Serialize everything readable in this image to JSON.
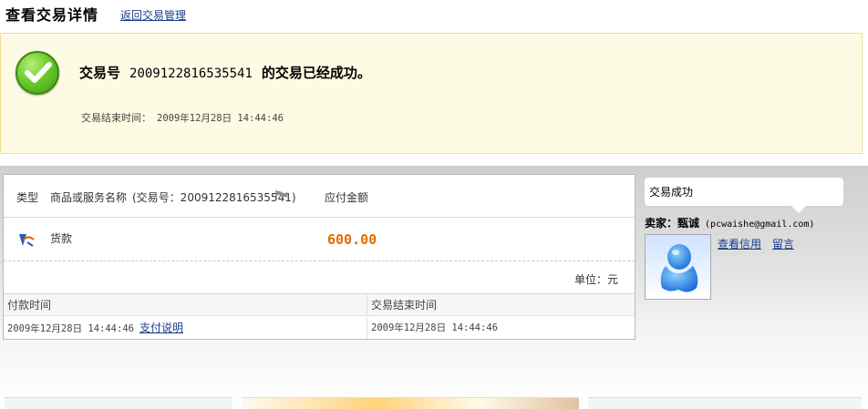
{
  "header": {
    "title": "查看交易详情",
    "back_link": "返回交易管理"
  },
  "success": {
    "prefix": "交易号",
    "trade_no": "2009122816535541",
    "suffix": "的交易已经成功。",
    "end_time_label": "交易结束时间：",
    "end_time_value": "2009年12月28日 14:44:46"
  },
  "order": {
    "col_type": "类型",
    "col_name": "商品或服务名称",
    "col_trade_no": "(交易号：2009122816535541)",
    "col_amount": "应付金额",
    "item_name": "货款",
    "item_amount": "600.00",
    "unit": "单位：元",
    "pay_time_header": "付款时间",
    "end_time_header": "交易结束时间",
    "pay_time_value": "2009年12月28日 14:44:46",
    "pay_note_link": "支付说明",
    "end_time_value": "2009年12月28日 14:44:46"
  },
  "seller": {
    "status": "交易成功",
    "label": "卖家：",
    "name": "甄诚",
    "email": "(pcwaishe@gmail.com)",
    "view_credit": "查看信用",
    "message": "留言"
  },
  "colors": {
    "link": "#1a3c8c",
    "amount": "#e06c00",
    "notice_bg": "#fefbe4",
    "success_green": "#5cb821"
  },
  "icons": {
    "success": "check-circle-icon",
    "trade_flag": "flag-icon",
    "item_type": "alipay-icon",
    "avatar": "user-avatar-icon"
  }
}
